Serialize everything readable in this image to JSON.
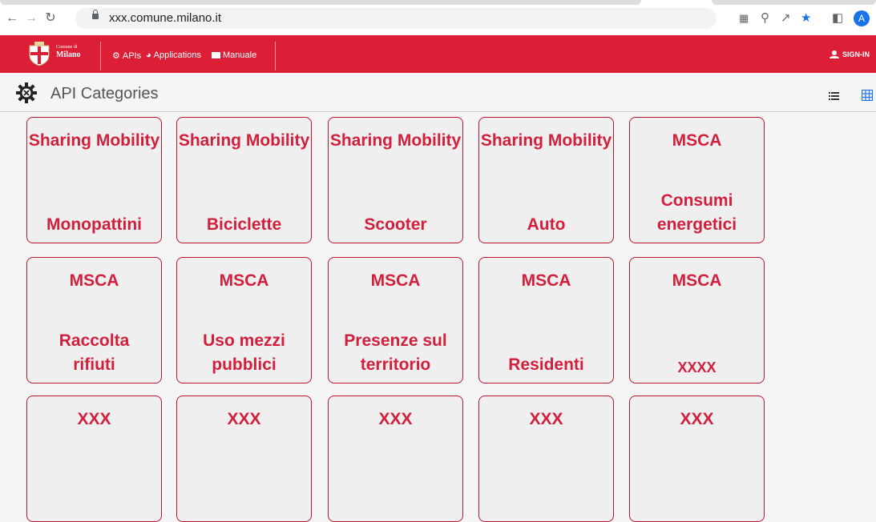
{
  "browser": {
    "url": "xxx.comune.milano.it",
    "avatar_letter": "A"
  },
  "header": {
    "logo_small": "Comune di",
    "logo_big": "Milano",
    "nav": [
      "APIs",
      "Applications",
      "Manuale"
    ],
    "signin": "SIGN-IN",
    "brand_color": "#dc1f36"
  },
  "page": {
    "title": "API Categories"
  },
  "cards": [
    {
      "top": "Sharing Mobility",
      "bottom": "Monopattini"
    },
    {
      "top": "Sharing Mobility",
      "bottom": "Biciclette"
    },
    {
      "top": "Sharing Mobility",
      "bottom": "Scooter"
    },
    {
      "top": "Sharing Mobility",
      "bottom": "Auto"
    },
    {
      "top": "MSCA",
      "bottom": "Consumi energetici"
    },
    {
      "top": "MSCA",
      "bottom": "Raccolta rifiuti"
    },
    {
      "top": "MSCA",
      "bottom": "Uso mezzi pubblici"
    },
    {
      "top": "MSCA",
      "bottom": "Presenze sul territorio"
    },
    {
      "top": "MSCA",
      "bottom": "Residenti"
    },
    {
      "top": "MSCA",
      "bottom": "xxxx"
    },
    {
      "top": "XXX",
      "bottom": ""
    },
    {
      "top": "XXX",
      "bottom": ""
    },
    {
      "top": "XXX",
      "bottom": ""
    },
    {
      "top": "XXX",
      "bottom": ""
    },
    {
      "top": "XXX",
      "bottom": ""
    }
  ]
}
